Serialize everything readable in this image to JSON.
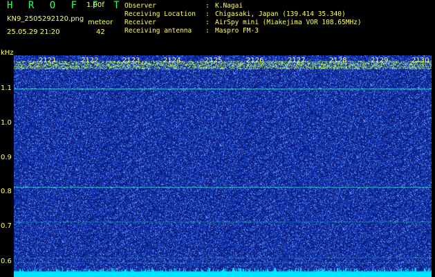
{
  "header": {
    "app_title": "H R O F F T",
    "version": "1.00f",
    "filename": "KN9_2505292120.png",
    "mode": "meteor",
    "timestamp": "25.05.29 21:20",
    "count": "42"
  },
  "info": [
    {
      "label": "Observer",
      "value": "K.Nagai"
    },
    {
      "label": "Receiving Location",
      "value": "Chigasaki, Japan (139.414 35.340)"
    },
    {
      "label": "Receiver",
      "value": "AirSpy mini (Miakejima VOR 108.65MHz)"
    },
    {
      "label": "Receiving antenna",
      "value": "Maspro FM-3"
    }
  ],
  "spectrogram": {
    "unit": "kHz",
    "y_ticks": [
      "1.1",
      "1.0",
      "0.9",
      "0.8",
      "0.7",
      "0.6"
    ],
    "x_ticks": [
      "2121",
      "2122",
      "2123",
      "2124",
      "2125",
      "2126",
      "2127",
      "2128",
      "2129",
      "2130"
    ],
    "colors": {
      "background": "#0a1f8a",
      "noise": "#3a7bff",
      "line": "#44e0d8",
      "top_band": "#7fe07a",
      "bottom_band": "#00e5ff"
    }
  }
}
